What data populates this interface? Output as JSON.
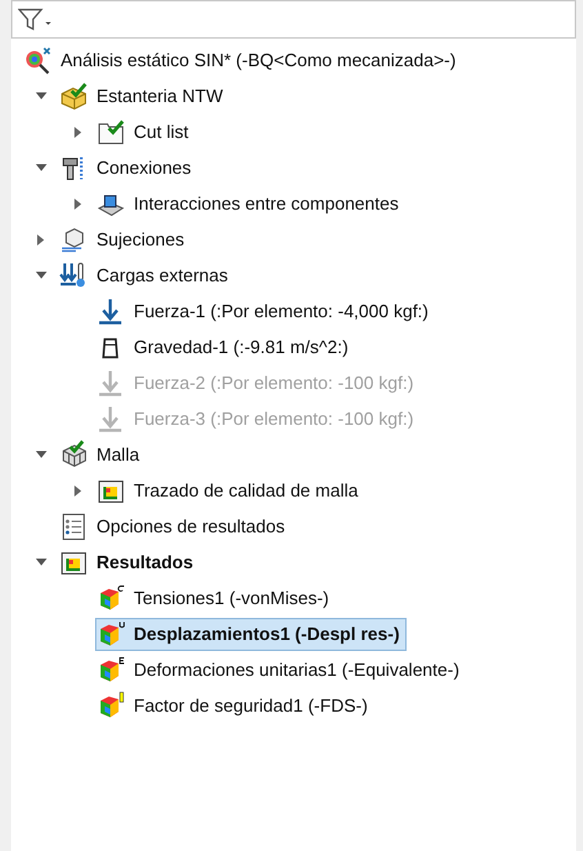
{
  "tree": [
    {
      "label": "Análisis estático SIN* (-BQ<Como mecanizada>-)",
      "kind": "study",
      "selected": false,
      "active": false,
      "disabled": false,
      "children": [
        {
          "label": "Estanteria NTW",
          "kind": "part",
          "expanded": true,
          "selected": false,
          "active": false,
          "disabled": false,
          "children": [
            {
              "label": "Cut list",
              "kind": "cutlist",
              "expanded": false,
              "selected": false,
              "active": false,
              "disabled": false
            }
          ]
        },
        {
          "label": "Conexiones",
          "kind": "connections",
          "expanded": true,
          "selected": false,
          "active": false,
          "disabled": false,
          "children": [
            {
              "label": "Interacciones entre componentes",
              "kind": "interaction",
              "expanded": false,
              "selected": false,
              "active": false,
              "disabled": false
            }
          ]
        },
        {
          "label": "Sujeciones",
          "kind": "fixtures",
          "expanded": false,
          "selected": false,
          "active": false,
          "disabled": false
        },
        {
          "label": "Cargas externas",
          "kind": "loads",
          "expanded": true,
          "selected": false,
          "active": false,
          "disabled": false,
          "children": [
            {
              "label": "Fuerza-1 (:Por elemento: -4,000 kgf:)",
              "kind": "force",
              "selected": false,
              "active": false,
              "disabled": false
            },
            {
              "label": "Gravedad-1 (:-9.81 m/s^2:)",
              "kind": "gravity",
              "selected": false,
              "active": false,
              "disabled": false
            },
            {
              "label": "Fuerza-2 (:Por elemento: -100 kgf:)",
              "kind": "force",
              "selected": false,
              "active": false,
              "disabled": true
            },
            {
              "label": "Fuerza-3 (:Por elemento: -100 kgf:)",
              "kind": "force",
              "selected": false,
              "active": false,
              "disabled": true
            }
          ]
        },
        {
          "label": "Malla",
          "kind": "mesh",
          "expanded": true,
          "selected": false,
          "active": false,
          "disabled": false,
          "children": [
            {
              "label": "Trazado de calidad de malla",
              "kind": "plot-folder",
              "expanded": false,
              "selected": false,
              "active": false,
              "disabled": false
            }
          ]
        },
        {
          "label": "Opciones de resultados",
          "kind": "options",
          "selected": false,
          "active": false,
          "disabled": false
        },
        {
          "label": "Resultados",
          "kind": "plot-folder",
          "expanded": true,
          "selected": false,
          "active": true,
          "disabled": false,
          "children": [
            {
              "label": "Tensiones1 (-vonMises-)",
              "kind": "stress-plot",
              "selected": false,
              "active": false,
              "disabled": false
            },
            {
              "label": "Desplazamientos1 (-Despl res-)",
              "kind": "displacement-plot",
              "selected": true,
              "active": true,
              "disabled": false
            },
            {
              "label": "Deformaciones unitarias1 (-Equivalente-)",
              "kind": "strain-plot",
              "selected": false,
              "active": false,
              "disabled": false
            },
            {
              "label": "Factor de seguridad1 (-FDS-)",
              "kind": "safety-plot",
              "selected": false,
              "active": false,
              "disabled": false
            }
          ]
        }
      ]
    }
  ]
}
